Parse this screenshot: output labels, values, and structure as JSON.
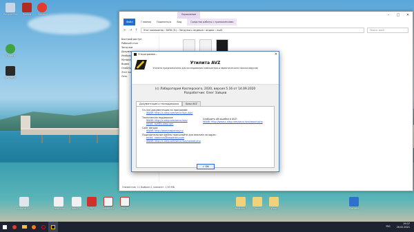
{
  "desktop": {
    "icons_left": [
      {
        "label": "Recycle Bin",
        "color": "#c9d6e8"
      },
      {
        "label": "Пресса",
        "color": "#b02b22"
      },
      {
        "label": "Яндекс",
        "color": "#e23c2d"
      },
      {
        "label": "uTorrent",
        "color": "#3fa340"
      },
      {
        "label": "DeviceOff",
        "color": "#2a2a2a"
      }
    ],
    "icons_bottom": [
      {
        "label": "Утилита АVZ"
      },
      {
        "label": "DemProg"
      },
      {
        "label": "Opera Min"
      },
      {
        "label": "PDF"
      },
      {
        "label": "Adobe Acr"
      },
      {
        "label": "Setup"
      },
      {
        "label": "Windows 7"
      },
      {
        "label": "Папка"
      },
      {
        "label": "Word"
      },
      {
        "label": "Корзина"
      }
    ]
  },
  "explorer": {
    "ribbon_tab": "Управление",
    "tab_file": "Файл",
    "tabs": [
      "Главная",
      "Поделиться",
      "Вид",
      "Средства работы с приложениями"
    ],
    "active_tab": "Управление",
    "address": "Этот компьютер › DATA (E:) › Загрузки с яндекса › яндекс › avz5",
    "search_placeholder": "Поиск: avz5",
    "nav": [
      "Быстрый доступ",
      "Рабочий стол",
      "Загрузки",
      "Документы",
      "Изображения",
      "Музыка",
      "Видео",
      "OneDrive",
      "Этот компьютер",
      "Сеть"
    ],
    "status": "Элементов: 11   Выбран 1 элемент: 1,50 МБ"
  },
  "dialog": {
    "title": "О программе...",
    "app_name": "Утилита AVZ",
    "description": "Утилита предназначена для исследования компьютера и эвристического поиска вирусов",
    "copyright": "(с) Лаборатория Касперского, 2020, версия 5.16 от 14.09.2020",
    "developer": "Разработчик: Олег Зайцев",
    "tabs": [
      "Документация и техподдержка",
      "Базы AVZ"
    ],
    "docs_label": "On-line документация по программе:",
    "docs_link": "WWW: http://z-oleg.com/secur/avz_doc/",
    "support_label": "Техническая поддержка:",
    "support_www": "WWW: http://z-oleg.com/secur/avz/",
    "support_email": "email: avz@z-oleg.com",
    "author_label": "Сайт автора:",
    "author_link": "WWW: http://www.kaspersky.ru/",
    "report_label": "Сообщить об ошибке в AVZ:",
    "report_link": "WWW: http://www.z-oleg.com/secur/avz/report.php",
    "files_label": "Подозрительные файлы присылайте для анализа на адрес:",
    "files_email": "email: newvirus@kaspersky.com",
    "files_www": "WWW: http://z-oleg.com/secur/avz/upload.php",
    "ok_label": "OK"
  },
  "taskbar": {
    "lang": "РУС",
    "time": "19:37",
    "date": "26.02.2021"
  }
}
